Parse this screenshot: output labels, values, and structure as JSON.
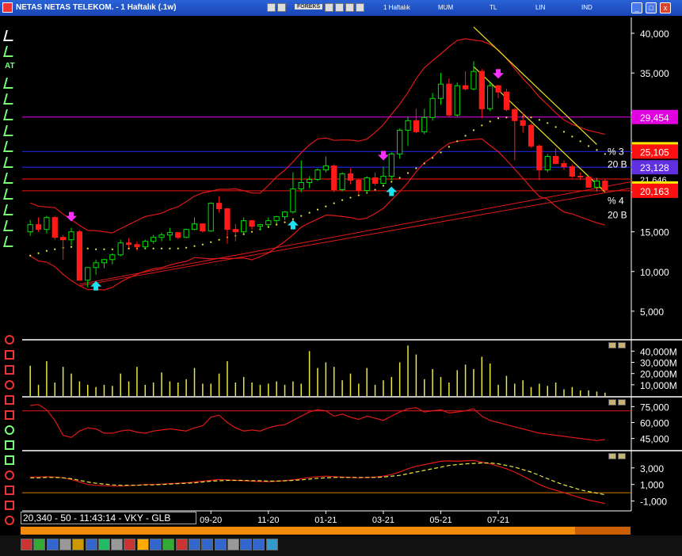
{
  "window": {
    "title": "NETAS NETAS TELEKOM. - 1 Haftalık (.1w)",
    "forex_label": "FOREKS",
    "toolbar_labels": [
      "1 Haftalık",
      "MUM",
      "TL",
      "LIN",
      "IND"
    ],
    "window_buttons": [
      "_",
      "□",
      "x"
    ]
  },
  "left_tools": [
    "pointer-tool",
    "pencil-tool",
    "AT",
    "vertical-line-tool",
    "horizontal-line-tool",
    "trend-line-tool",
    "channel-tool",
    "fibonacci-tool",
    "gann-tool",
    "parallel-tool",
    "fan-tool",
    "arc-tool",
    "text-tool",
    "eraser-tool"
  ],
  "status": {
    "text": "20,340 - 50 - 11:43:14 - VKY - GLB"
  },
  "colors": {
    "up": "#00e000",
    "down": "#ff1a1a",
    "volume": "#e8e840",
    "ma_dotted": "#e8e840",
    "bollinger": "#e01818",
    "trend_yellow": "#e8e020",
    "level_magenta": "#c000c0",
    "level_blue": "#2020c0",
    "level_red": "#c01010",
    "axis_text": "#ffffff",
    "arrow_up": "#20e0f0",
    "arrow_down": "#ff30ff"
  },
  "chart_data": [
    {
      "type": "candlestick",
      "panel": "price",
      "x_tick_labels": [
        "09-20",
        "11-20",
        "01-21",
        "03-21",
        "05-21",
        "07-21"
      ],
      "y_ticks": [
        5000,
        10000,
        15000,
        20000,
        25000,
        30000,
        35000,
        40000
      ],
      "y_tick_labels": [
        "5,000",
        "10,000",
        "15,000",
        "20,000",
        "25,000",
        "30,000",
        "35,000",
        "40,000"
      ],
      "ylim": [
        1500,
        42000
      ],
      "x_count": 62,
      "x_tick_index": [
        22,
        29,
        36,
        43,
        50,
        57
      ],
      "candles": [
        [
          15.0,
          16.5,
          14.5,
          15.9
        ],
        [
          15.9,
          16.8,
          15.0,
          15.3
        ],
        [
          15.3,
          17.0,
          14.8,
          16.8
        ],
        [
          16.8,
          17.0,
          14.0,
          14.3
        ],
        [
          14.3,
          14.6,
          11.5,
          14.0
        ],
        [
          14.0,
          15.5,
          13.3,
          15.0
        ],
        [
          15.0,
          15.2,
          10.0,
          8.9
        ],
        [
          8.9,
          10.5,
          8.0,
          10.5
        ],
        [
          10.5,
          11.5,
          9.6,
          11.1
        ],
        [
          11.1,
          11.6,
          10.4,
          11.5
        ],
        [
          11.5,
          12.3,
          10.9,
          12.1
        ],
        [
          12.1,
          14.0,
          11.9,
          13.6
        ],
        [
          13.6,
          14.2,
          13.0,
          13.4
        ],
        [
          13.4,
          13.8,
          12.6,
          13.1
        ],
        [
          13.1,
          14.0,
          12.8,
          13.8
        ],
        [
          13.8,
          14.6,
          13.5,
          14.3
        ],
        [
          14.3,
          14.9,
          13.8,
          14.6
        ],
        [
          14.6,
          15.5,
          13.9,
          14.9
        ],
        [
          14.9,
          15.0,
          14.1,
          14.3
        ],
        [
          14.3,
          15.4,
          14.2,
          15.3
        ],
        [
          15.3,
          16.8,
          15.2,
          16.0
        ],
        [
          16.0,
          16.0,
          14.9,
          15.1
        ],
        [
          15.1,
          18.7,
          15.0,
          18.6
        ],
        [
          18.6,
          19.5,
          17.4,
          17.9
        ],
        [
          17.9,
          18.0,
          13.5,
          15.3
        ],
        [
          15.3,
          16.0,
          13.8,
          15.0
        ],
        [
          15.0,
          16.8,
          14.8,
          16.4
        ],
        [
          16.4,
          16.5,
          15.3,
          15.7
        ],
        [
          15.7,
          16.0,
          15.2,
          15.9
        ],
        [
          15.9,
          16.8,
          15.6,
          16.4
        ],
        [
          16.4,
          17.0,
          16.0,
          16.9
        ],
        [
          16.9,
          17.6,
          16.5,
          17.5
        ],
        [
          17.5,
          22.5,
          17.3,
          20.4
        ],
        [
          20.4,
          24.0,
          20.0,
          21.2
        ],
        [
          21.2,
          22.0,
          20.5,
          21.6
        ],
        [
          21.6,
          23.0,
          21.4,
          22.8
        ],
        [
          22.8,
          24.5,
          22.5,
          23.3
        ],
        [
          23.3,
          23.5,
          20.0,
          20.3
        ],
        [
          20.3,
          22.5,
          20.1,
          22.3
        ],
        [
          22.3,
          23.0,
          21.0,
          21.5
        ],
        [
          21.5,
          21.6,
          19.8,
          20.2
        ],
        [
          20.2,
          22.0,
          19.8,
          21.8
        ],
        [
          21.8,
          22.5,
          20.8,
          21.1
        ],
        [
          21.1,
          23.2,
          21.0,
          22.0
        ],
        [
          22.0,
          25.0,
          21.5,
          24.8
        ],
        [
          24.8,
          28.0,
          24.2,
          27.8
        ],
        [
          27.8,
          29.5,
          25.8,
          29.0
        ],
        [
          29.0,
          30.5,
          27.4,
          27.6
        ],
        [
          27.6,
          30.5,
          27.3,
          29.4
        ],
        [
          29.4,
          32.5,
          29.0,
          31.8
        ],
        [
          31.8,
          35.0,
          31.0,
          33.6
        ],
        [
          33.6,
          34.3,
          29.5,
          29.7
        ],
        [
          29.7,
          33.8,
          29.5,
          33.4
        ],
        [
          33.4,
          35.2,
          32.8,
          33.0
        ],
        [
          33.0,
          36.5,
          32.8,
          35.2
        ],
        [
          35.2,
          35.5,
          29.3,
          30.5
        ],
        [
          30.5,
          33.8,
          30.2,
          33.4
        ],
        [
          33.4,
          33.5,
          31.8,
          32.6
        ],
        [
          32.6,
          33.0,
          30.2,
          30.4
        ],
        [
          30.4,
          30.6,
          24.0,
          29.0
        ],
        [
          29.0,
          30.0,
          27.5,
          28.4
        ],
        [
          28.4,
          28.6,
          25.6,
          25.8
        ],
        [
          25.8,
          26.0,
          21.5,
          22.8
        ],
        [
          22.8,
          24.8,
          22.5,
          24.5
        ],
        [
          24.5,
          25.5,
          23.5,
          23.6
        ],
        [
          23.6,
          24.0,
          22.8,
          23.2
        ],
        [
          23.2,
          23.5,
          21.8,
          22.0
        ],
        [
          22.0,
          22.5,
          21.5,
          21.9
        ],
        [
          21.9,
          22.0,
          20.6,
          20.6
        ],
        [
          20.6,
          21.8,
          20.1,
          21.4
        ],
        [
          21.4,
          21.6,
          20.0,
          20.3
        ]
      ],
      "overlays": {
        "ma_dotted": [
          12.0,
          12.3,
          12.6,
          12.8,
          13.0,
          13.1,
          13.1,
          12.9,
          12.8,
          12.8,
          12.8,
          12.8,
          12.9,
          12.9,
          12.9,
          12.9,
          12.9,
          12.9,
          12.9,
          13.0,
          13.2,
          13.4,
          13.7,
          14.0,
          14.3,
          14.5,
          14.7,
          15.0,
          15.3,
          15.6,
          15.9,
          16.2,
          16.6,
          17.0,
          17.4,
          17.8,
          18.2,
          18.6,
          19.0,
          19.3,
          19.6,
          19.9,
          20.3,
          20.8,
          21.3,
          21.8,
          22.4,
          23.0,
          23.6,
          24.3,
          25.0,
          25.7,
          26.4,
          27.1,
          27.8,
          28.4,
          28.9,
          29.3,
          29.4,
          29.5,
          29.5,
          29.4,
          29.1,
          28.7,
          28.2,
          27.6,
          27.0,
          26.4,
          25.8,
          25.3,
          24.8
        ],
        "bb_upper": [
          null,
          null,
          null,
          null,
          null,
          null,
          null,
          null,
          null,
          null,
          null,
          null,
          null,
          null,
          null,
          null,
          null,
          null,
          null,
          null,
          null,
          null,
          null,
          null,
          null,
          null,
          null,
          null,
          null,
          null,
          null,
          null,
          null,
          null,
          null,
          null,
          null,
          null,
          null,
          null,
          null,
          null,
          null,
          null,
          null,
          null,
          null,
          null,
          null,
          null,
          null,
          null,
          null,
          null,
          null,
          null,
          null,
          null,
          null,
          null,
          null,
          null,
          null,
          null,
          null,
          null,
          null,
          null,
          null,
          null,
          null
        ],
        "bb_lower": []
      },
      "levels": [
        {
          "value": 29.454,
          "label": "29,454",
          "color": "#c000c0",
          "box": "#e000e0"
        },
        {
          "value": 25.105,
          "label": "25,105",
          "color": "#2020c0",
          "box": "#ff1010"
        },
        {
          "value": 23.128,
          "label": "23,128",
          "color": "#2020c0",
          "box": "#6030e0"
        },
        {
          "value": 21.646,
          "label": "21,646",
          "color": "#c01010",
          "box": null
        },
        {
          "value": 20.163,
          "label": "20,163",
          "color": "#c01010",
          "box": "#ff1010"
        }
      ],
      "annotations": [
        "% 3",
        "20 B",
        "% 4",
        "20 B"
      ],
      "signals": {
        "buy": [
          8,
          32,
          44
        ],
        "sell": [
          5,
          43,
          57
        ]
      }
    },
    {
      "type": "bar",
      "panel": "volume",
      "y_tick_labels": [
        "10,000M",
        "20,000M",
        "30,000M",
        "40,000M"
      ],
      "ylim": [
        0,
        48000
      ],
      "values": [
        27,
        10,
        31,
        12,
        26,
        20,
        13,
        10,
        8,
        10,
        9,
        20,
        13,
        26,
        10,
        12,
        21,
        13,
        12,
        15,
        25,
        11,
        11,
        20,
        31,
        12,
        17,
        12,
        10,
        11,
        13,
        10,
        13,
        11,
        40,
        25,
        30,
        26,
        14,
        20,
        11,
        25,
        10,
        14,
        17,
        30,
        45,
        37,
        15,
        24,
        17,
        12,
        23,
        28,
        24,
        35,
        29,
        10,
        18,
        11,
        14,
        8,
        11,
        9,
        12,
        6,
        8,
        5,
        5,
        4,
        3
      ]
    },
    {
      "type": "line",
      "panel": "oscillator",
      "y_tick_labels": [
        "45,000",
        "60,000",
        "75,000"
      ],
      "ylim": [
        35000,
        82000
      ],
      "ref_level": 71000,
      "values": [
        76000,
        77000,
        72000,
        62000,
        48000,
        46000,
        52000,
        55000,
        54000,
        50000,
        50000,
        52000,
        53000,
        51000,
        50000,
        52000,
        53000,
        54000,
        53000,
        52000,
        55000,
        57000,
        65000,
        67000,
        60000,
        55000,
        52000,
        53000,
        52000,
        55000,
        57000,
        58000,
        62000,
        66000,
        70000,
        72000,
        71000,
        66000,
        68000,
        65000,
        63000,
        66000,
        64000,
        62000,
        66000,
        70000,
        73000,
        74000,
        70000,
        71000,
        72000,
        69000,
        70000,
        71000,
        73000,
        66000,
        62000,
        60000,
        58000,
        56000,
        54000,
        52000,
        50000,
        49000,
        48000,
        47000,
        46000,
        45000,
        44000,
        43000,
        44000
      ]
    },
    {
      "type": "line",
      "panel": "macd",
      "y_tick_labels": [
        "-1,000",
        "1,000",
        "3,000"
      ],
      "ylim": [
        -2000,
        4800
      ],
      "ref_level": 0,
      "series": [
        {
          "style": "solid",
          "values": [
            1900,
            1900,
            1950,
            1900,
            1800,
            1600,
            1300,
            1000,
            900,
            850,
            800,
            800,
            850,
            900,
            1000,
            1000,
            1050,
            1100,
            1150,
            1200,
            1300,
            1400,
            1500,
            1600,
            1550,
            1500,
            1450,
            1400,
            1350,
            1350,
            1400,
            1450,
            1550,
            1700,
            1850,
            1950,
            2000,
            1950,
            1900,
            1850,
            1800,
            1850,
            1900,
            2000,
            2200,
            2500,
            2900,
            3200,
            3400,
            3600,
            3800,
            3850,
            3800,
            3850,
            3900,
            3700,
            3500,
            3200,
            2900,
            2500,
            2000,
            1500,
            1000,
            600,
            300,
            0,
            -300,
            -600,
            -900,
            -1100,
            -1300
          ]
        },
        {
          "style": "dashed",
          "values": [
            1800,
            1800,
            1850,
            1850,
            1800,
            1700,
            1500,
            1300,
            1150,
            1050,
            950,
            900,
            900,
            900,
            950,
            950,
            1000,
            1050,
            1100,
            1150,
            1200,
            1300,
            1400,
            1450,
            1500,
            1500,
            1500,
            1450,
            1450,
            1400,
            1400,
            1450,
            1500,
            1550,
            1650,
            1750,
            1800,
            1850,
            1850,
            1850,
            1850,
            1850,
            1850,
            1900,
            2000,
            2100,
            2300,
            2500,
            2700,
            2900,
            3100,
            3300,
            3400,
            3500,
            3550,
            3600,
            3600,
            3500,
            3300,
            3100,
            2800,
            2500,
            2100,
            1700,
            1300,
            950,
            650,
            350,
            150,
            -50,
            -250
          ]
        }
      ]
    }
  ]
}
